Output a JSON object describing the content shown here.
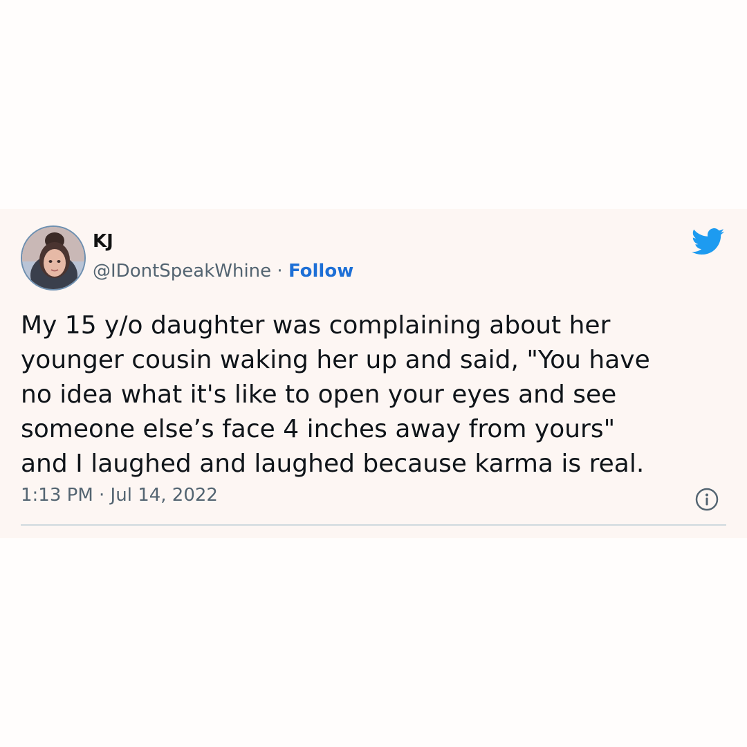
{
  "tweet": {
    "author_name": "KJ",
    "handle": "@IDontSpeakWhine",
    "separator": " · ",
    "follow_label": "Follow",
    "text_lines": [
      "My 15 y/o daughter was complaining about her",
      "younger cousin waking her up and said, \"You have",
      "no idea what it's like to open your eyes and see",
      "someone else’s face 4 inches away from yours\"",
      "and I laughed and laughed because karma is real."
    ],
    "timestamp": "1:13 PM · Jul 14, 2022"
  },
  "icons": {
    "brand": "twitter-bird-icon",
    "info": "info-icon"
  },
  "colors": {
    "background": "#fffdfc",
    "card": "#fdf6f3",
    "text": "#0f1419",
    "secondary": "#536471",
    "follow": "#1d6fd6",
    "twitter_blue": "#1d9bf0"
  }
}
